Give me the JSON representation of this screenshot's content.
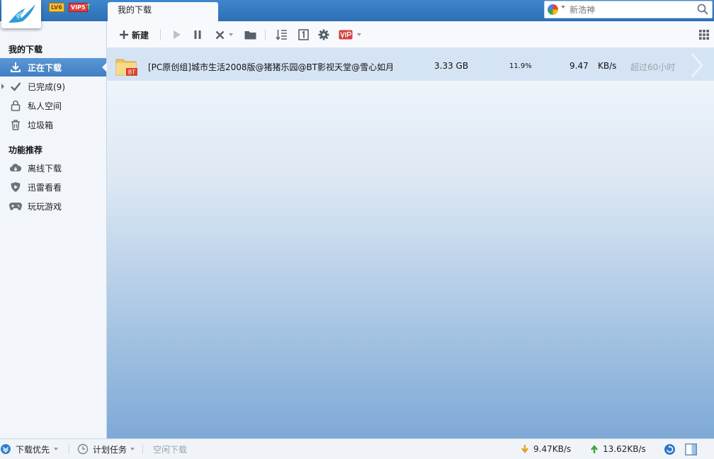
{
  "header": {
    "level_badge": "LV6",
    "vip_badge": "VIP5",
    "active_tab": "我的下载",
    "search": {
      "placeholder": "新浩神"
    }
  },
  "toolbar": {
    "new_label": "新建"
  },
  "sidebar": {
    "section_downloads": "我的下载",
    "downloads": [
      {
        "label": "正在下载",
        "icon": "download-icon"
      },
      {
        "label": "已完成(9)",
        "icon": "checkmark-icon"
      },
      {
        "label": "私人空间",
        "icon": "lock-icon"
      },
      {
        "label": "垃圾箱",
        "icon": "trash-icon"
      }
    ],
    "section_features": "功能推荐",
    "features": [
      {
        "label": "离线下载",
        "icon": "cloud-icon"
      },
      {
        "label": "迅雷看看",
        "icon": "play-shield-icon"
      },
      {
        "label": "玩玩游戏",
        "icon": "gamepad-icon"
      }
    ]
  },
  "tasks": [
    {
      "name": "[PC原创组]城市生活2008版@猪猪乐园@BT影视天堂@雪心如月",
      "type_badge": "BT",
      "size": "3.33 GB",
      "progress": "11.9%",
      "speed": "9.47",
      "speed_unit": "KB/s",
      "remaining": "超过60小时"
    }
  ],
  "statusbar": {
    "priority_label": "下载优先",
    "schedule_label": "计划任务",
    "idle_label": "空闲下载",
    "download_speed": "9.47KB/s",
    "upload_speed": "13.62KB/s"
  },
  "colors": {
    "titlebar": "#3578c0",
    "sidebar_active": "#4b8ccd",
    "row_selected": "#d5e4f4",
    "download_arrow": "#e3a21a",
    "upload_arrow": "#3aa53a"
  }
}
